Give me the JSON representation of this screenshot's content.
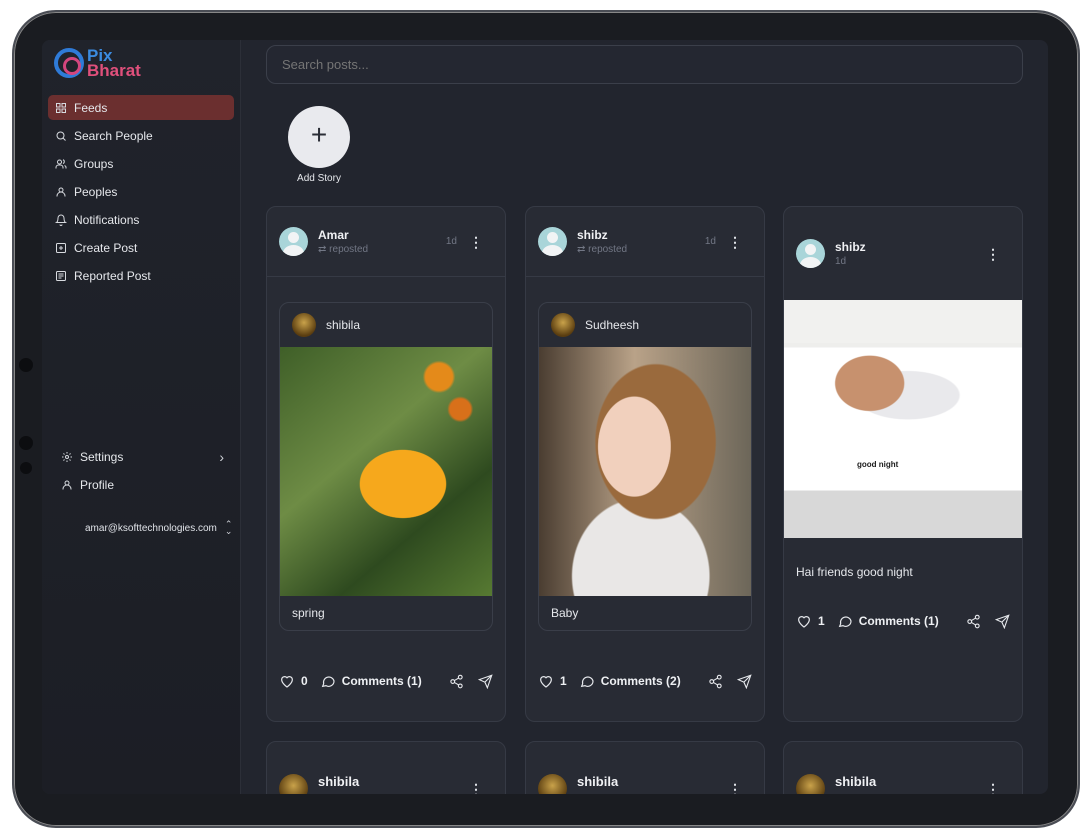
{
  "app": {
    "logo_line1": "Pix",
    "logo_line2": "Bharat"
  },
  "sidebar": {
    "items": [
      {
        "label": "Feeds",
        "icon": "grid-icon",
        "active": true
      },
      {
        "label": "Search People",
        "icon": "search-icon"
      },
      {
        "label": "Groups",
        "icon": "users-icon"
      },
      {
        "label": "Peoples",
        "icon": "user-icon"
      },
      {
        "label": "Notifications",
        "icon": "bell-icon"
      },
      {
        "label": "Create Post",
        "icon": "plus-square-icon"
      },
      {
        "label": "Reported Post",
        "icon": "newspaper-icon"
      }
    ],
    "bottom": [
      {
        "label": "Settings",
        "icon": "gear-icon"
      },
      {
        "label": "Profile",
        "icon": "user-icon"
      }
    ],
    "email": "amar@ksofttechnologies.com"
  },
  "search": {
    "placeholder": "Search posts..."
  },
  "story": {
    "label": "Add Story"
  },
  "posts": [
    {
      "author": "Amar",
      "sub": "reposted",
      "time": "1d",
      "inner_author": "shibila",
      "caption": "spring",
      "likes": "0",
      "comments": "Comments (1)"
    },
    {
      "author": "shibz",
      "sub": "reposted",
      "time": "1d",
      "inner_author": "Sudheesh",
      "caption": "Baby",
      "likes": "1",
      "comments": "Comments (2)"
    },
    {
      "author": "shibz",
      "sub": "1d",
      "image_text": "good night",
      "caption": "Hai friends good night",
      "likes": "1",
      "comments": "Comments (1)"
    }
  ],
  "next_posts": [
    {
      "author": "shibila"
    },
    {
      "author": "shibila"
    },
    {
      "author": "shibila"
    }
  ],
  "colors": {
    "accent_active": "#6b2f2f",
    "background": "#22252e",
    "card": "#282b34"
  }
}
